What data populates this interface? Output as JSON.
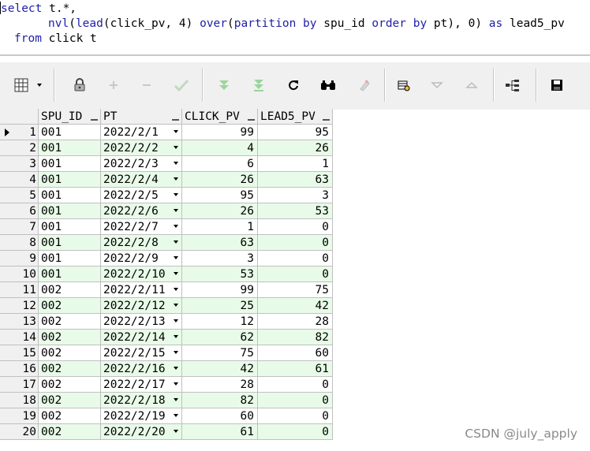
{
  "editor": {
    "line1": [
      "select",
      " t.*,"
    ],
    "line2": [
      "nvl",
      "(",
      "lead",
      "(click_pv, ",
      "4",
      ") ",
      "over",
      "(",
      "partition by",
      " spu_id ",
      "order by",
      " pt), ",
      "0",
      ") ",
      "as",
      " lead5_pv"
    ],
    "line3": [
      "from",
      " click t"
    ]
  },
  "toolbar": {
    "buttons": [
      "grid-view-icon",
      "dropdown-arrow-icon",
      "lock-icon",
      "add-icon",
      "remove-icon",
      "check-icon",
      "fetch-next-icon",
      "fetch-all-icon",
      "refresh-icon",
      "find-icon",
      "clear-icon",
      "query-by-example-icon",
      "sort-descending-icon",
      "sort-ascending-icon",
      "tree-view-icon",
      "save-icon"
    ]
  },
  "grid": {
    "columns": [
      "SPU_ID",
      "PT",
      "CLICK_PV",
      "LEAD5_PV"
    ],
    "rows": [
      {
        "n": "1",
        "spu_id": "001",
        "pt": "2022/2/1",
        "click_pv": "99",
        "lead5_pv": "95"
      },
      {
        "n": "2",
        "spu_id": "001",
        "pt": "2022/2/2",
        "click_pv": "4",
        "lead5_pv": "26"
      },
      {
        "n": "3",
        "spu_id": "001",
        "pt": "2022/2/3",
        "click_pv": "6",
        "lead5_pv": "1"
      },
      {
        "n": "4",
        "spu_id": "001",
        "pt": "2022/2/4",
        "click_pv": "26",
        "lead5_pv": "63"
      },
      {
        "n": "5",
        "spu_id": "001",
        "pt": "2022/2/5",
        "click_pv": "95",
        "lead5_pv": "3"
      },
      {
        "n": "6",
        "spu_id": "001",
        "pt": "2022/2/6",
        "click_pv": "26",
        "lead5_pv": "53"
      },
      {
        "n": "7",
        "spu_id": "001",
        "pt": "2022/2/7",
        "click_pv": "1",
        "lead5_pv": "0"
      },
      {
        "n": "8",
        "spu_id": "001",
        "pt": "2022/2/8",
        "click_pv": "63",
        "lead5_pv": "0"
      },
      {
        "n": "9",
        "spu_id": "001",
        "pt": "2022/2/9",
        "click_pv": "3",
        "lead5_pv": "0"
      },
      {
        "n": "10",
        "spu_id": "001",
        "pt": "2022/2/10",
        "click_pv": "53",
        "lead5_pv": "0"
      },
      {
        "n": "11",
        "spu_id": "002",
        "pt": "2022/2/11",
        "click_pv": "99",
        "lead5_pv": "75"
      },
      {
        "n": "12",
        "spu_id": "002",
        "pt": "2022/2/12",
        "click_pv": "25",
        "lead5_pv": "42"
      },
      {
        "n": "13",
        "spu_id": "002",
        "pt": "2022/2/13",
        "click_pv": "12",
        "lead5_pv": "28"
      },
      {
        "n": "14",
        "spu_id": "002",
        "pt": "2022/2/14",
        "click_pv": "62",
        "lead5_pv": "82"
      },
      {
        "n": "15",
        "spu_id": "002",
        "pt": "2022/2/15",
        "click_pv": "75",
        "lead5_pv": "60"
      },
      {
        "n": "16",
        "spu_id": "002",
        "pt": "2022/2/16",
        "click_pv": "42",
        "lead5_pv": "61"
      },
      {
        "n": "17",
        "spu_id": "002",
        "pt": "2022/2/17",
        "click_pv": "28",
        "lead5_pv": "0"
      },
      {
        "n": "18",
        "spu_id": "002",
        "pt": "2022/2/18",
        "click_pv": "82",
        "lead5_pv": "0"
      },
      {
        "n": "19",
        "spu_id": "002",
        "pt": "2022/2/19",
        "click_pv": "60",
        "lead5_pv": "0"
      },
      {
        "n": "20",
        "spu_id": "002",
        "pt": "2022/2/20",
        "click_pv": "61",
        "lead5_pv": "0"
      }
    ]
  },
  "watermark": "CSDN @july_apply",
  "colors": {
    "keyword": "#1f1fa8",
    "alt_row": "#e8fbe8",
    "header": "#f0f0f0"
  }
}
